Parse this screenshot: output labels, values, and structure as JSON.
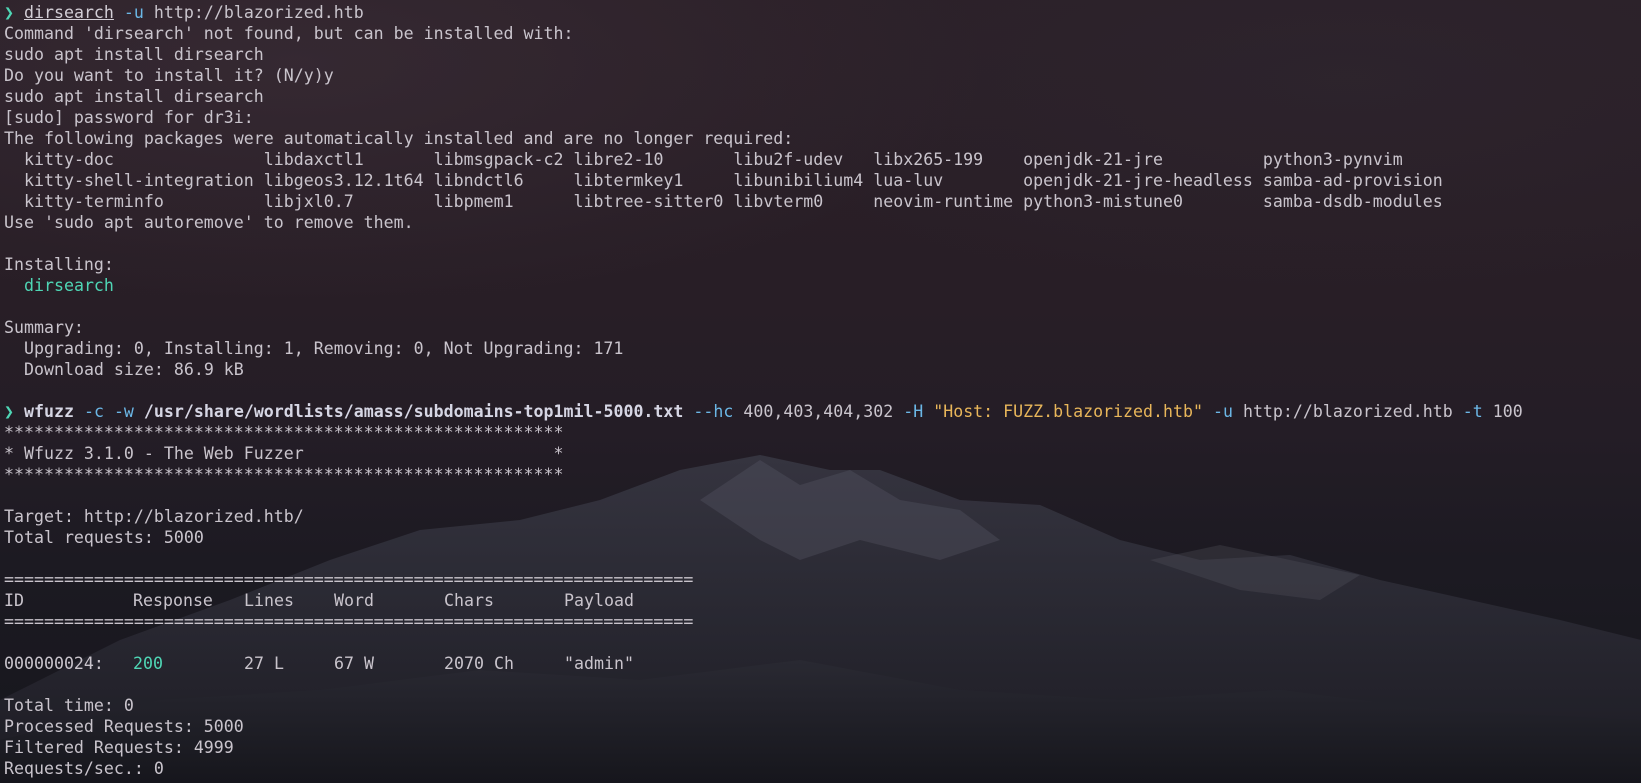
{
  "prompt_glyph": "❯",
  "cmd1": {
    "program": "dirsearch",
    "flag": "-u",
    "url": "http://blazorized.htb"
  },
  "apt_output": {
    "not_found": "Command 'dirsearch' not found, but can be installed with:",
    "suggest": "sudo apt install dirsearch",
    "ask": "Do you want to install it? (N/y)y",
    "run": "sudo apt install dirsearch",
    "sudo_prompt": "[sudo] password for dr3i:",
    "auto_installed": "The following packages were automatically installed and are no longer required:",
    "packages": [
      [
        "kitty-doc",
        "libdaxctl1",
        "libmsgpack-c2",
        "libre2-10",
        "libu2f-udev",
        "libx265-199",
        "openjdk-21-jre",
        "python3-pynvim"
      ],
      [
        "kitty-shell-integration",
        "libgeos3.12.1t64",
        "libndctl6",
        "libtermkey1",
        "libunibilium4",
        "lua-luv",
        "openjdk-21-jre-headless",
        "samba-ad-provision"
      ],
      [
        "kitty-terminfo",
        "libjxl0.7",
        "libpmem1",
        "libtree-sitter0",
        "libvterm0",
        "neovim-runtime",
        "python3-mistune0",
        "samba-dsdb-modules"
      ]
    ],
    "autoremove": "Use 'sudo apt autoremove' to remove them.",
    "installing_label": "Installing:",
    "installing_pkg": "dirsearch",
    "summary_label": "Summary:",
    "summary_counts": "Upgrading: 0, Installing: 1, Removing: 0, Not Upgrading: 171",
    "download_size": "Download size: 86.9 kB"
  },
  "cmd2": {
    "program": "wfuzz",
    "flag_c": "-c",
    "flag_w": "-w",
    "wordlist": "/usr/share/wordlists/amass/subdomains-top1mil-5000.txt",
    "flag_hc": "--hc",
    "hc_value": "400,403,404,302",
    "flag_H": "-H",
    "header": "\"Host: FUZZ.blazorized.htb\"",
    "flag_u": "-u",
    "url": "http://blazorized.htb",
    "flag_t": "-t",
    "threads": "100"
  },
  "wfuzz_output": {
    "stars": "********************************************************",
    "banner": "* Wfuzz 3.1.0 - The Web Fuzzer                         *",
    "target": "Target: http://blazorized.htb/",
    "total_requests": "Total requests: 5000",
    "separator": "=====================================================================",
    "headers": [
      "ID",
      "Response",
      "Lines",
      "Word",
      "Chars",
      "Payload"
    ],
    "result": {
      "id": "000000024:",
      "response": "200",
      "lines": "27 L",
      "word": "67 W",
      "chars": "2070 Ch",
      "payload": "\"admin\""
    },
    "total_time": "Total time: 0",
    "processed": "Processed Requests: 5000",
    "filtered": "Filtered Requests: 4999",
    "rate": "Requests/sec.: 0"
  },
  "colors": {
    "prompt": "#4fd6b5",
    "flag": "#6bb7e6",
    "string": "#e8b65a",
    "status_ok": "#4fd6b5"
  }
}
